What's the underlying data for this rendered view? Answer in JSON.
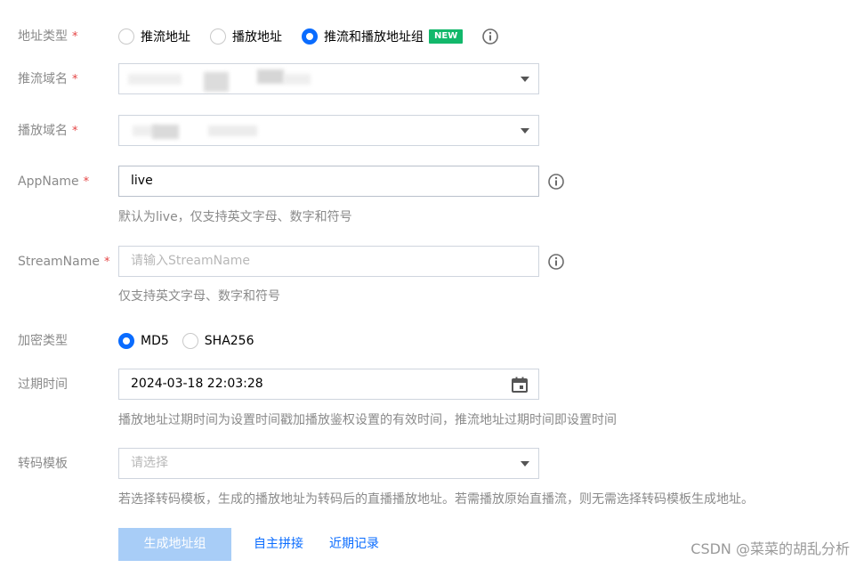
{
  "address_type": {
    "label": "地址类型",
    "required_mark": "*",
    "options": [
      {
        "label": "推流地址",
        "selected": false
      },
      {
        "label": "播放地址",
        "selected": false
      },
      {
        "label": "推流和播放地址组",
        "selected": true
      }
    ],
    "new_badge": "NEW"
  },
  "push_domain": {
    "label": "推流域名",
    "required_mark": "*"
  },
  "play_domain": {
    "label": "播放域名",
    "required_mark": "*"
  },
  "app_name": {
    "label": "AppName",
    "required_mark": "*",
    "value": "live",
    "hint": "默认为live，仅支持英文字母、数字和符号"
  },
  "stream_name": {
    "label": "StreamName",
    "required_mark": "*",
    "placeholder": "请输入StreamName",
    "hint": "仅支持英文字母、数字和符号"
  },
  "encryption": {
    "label": "加密类型",
    "options": [
      {
        "label": "MD5",
        "selected": true
      },
      {
        "label": "SHA256",
        "selected": false
      }
    ]
  },
  "expiry": {
    "label": "过期时间",
    "value": "2024-03-18 22:03:28",
    "hint": "播放地址过期时间为设置时间戳加播放鉴权设置的有效时间，推流地址过期时间即设置时间"
  },
  "transcode": {
    "label": "转码模板",
    "placeholder": "请选择",
    "hint": "若选择转码模板，生成的播放地址为转码后的直播播放地址。若需播放原始直播流，则无需选择转码模板生成地址。"
  },
  "actions": {
    "generate": "生成地址组",
    "custom_splice": "自主拼接",
    "recent_records": "近期记录"
  },
  "watermark": "CSDN @菜菜的胡乱分析",
  "colors": {
    "primary": "#0a6cff",
    "primary_disabled": "#a8cdf7",
    "badge_green": "#12b86b",
    "required_red": "#e54545"
  }
}
